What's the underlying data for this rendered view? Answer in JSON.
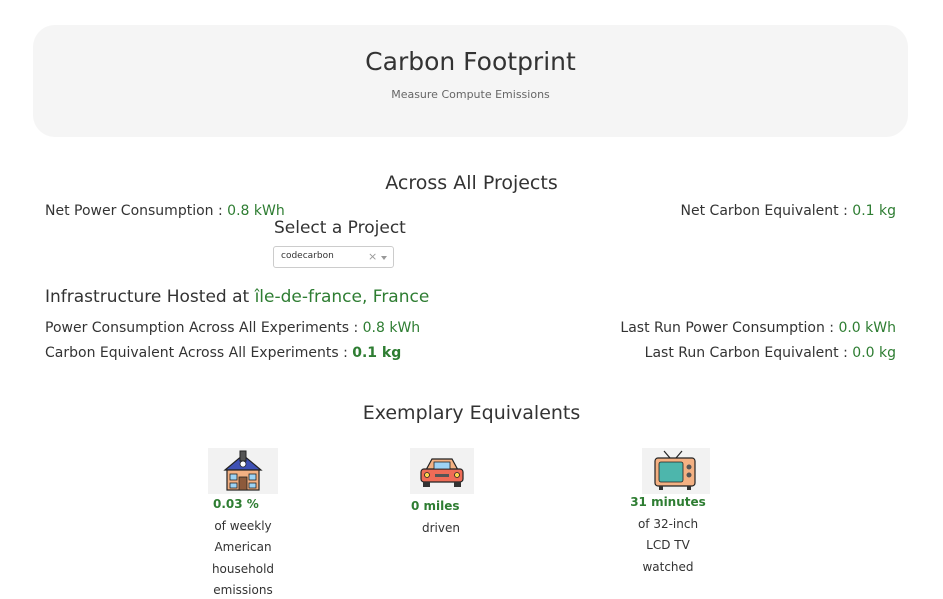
{
  "header": {
    "title": "Carbon Footprint",
    "subtitle": "Measure Compute Emissions"
  },
  "across_projects": {
    "title": "Across All Projects",
    "net_power_label": "Net Power Consumption : ",
    "net_power_value": "0.8 kWh",
    "net_carbon_label": "Net Carbon Equivalent : ",
    "net_carbon_value": "0.1 kg"
  },
  "project_select": {
    "label": "Select a Project",
    "selected": "codecarbon",
    "clear": "×"
  },
  "infrastructure": {
    "label": "Infrastructure Hosted at ",
    "location": "île-de-france, France",
    "power_all_label": "Power Consumption Across All Experiments : ",
    "power_all_value": "0.8 kWh",
    "carbon_all_label": "Carbon Equivalent Across All Experiments : ",
    "carbon_all_value": "0.1 kg",
    "last_power_label": "Last Run Power Consumption : ",
    "last_power_value": "0.0 kWh",
    "last_carbon_label": "Last Run Carbon Equivalent : ",
    "last_carbon_value": "0.0 kg"
  },
  "equivalents": {
    "title": "Exemplary Equivalents",
    "items": [
      {
        "icon": "house-icon",
        "value": "0.03 %",
        "lines": [
          "of weekly",
          "American",
          "household",
          "emissions"
        ]
      },
      {
        "icon": "car-icon",
        "value": "0 miles",
        "lines": [
          "driven"
        ]
      },
      {
        "icon": "tv-icon",
        "value": "31 minutes",
        "lines": [
          "of 32-inch",
          "LCD TV",
          "watched"
        ]
      }
    ]
  },
  "colors": {
    "accent_green": "#2e7d32",
    "hero_background": "#f5f5f5"
  }
}
